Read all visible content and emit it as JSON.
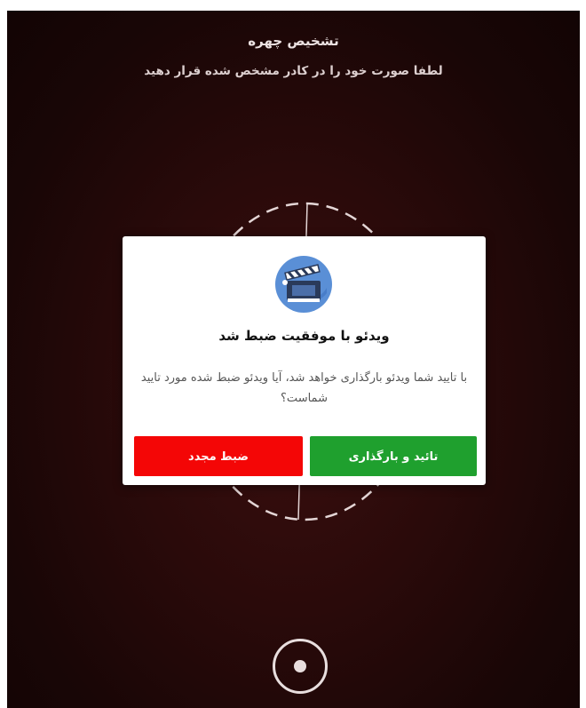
{
  "header": {
    "title": "تشخیص چهره",
    "subtitle": "لطفا صورت خود را در کادر مشخص شده قرار دهید"
  },
  "dialog": {
    "icon": "video-clapperboard-icon",
    "title": "ویدئو با موفقیت ضبط شد",
    "message": "با تایید شما ویدئو بارگذاری خواهد شد، آیا ویدئو ضبط شده مورد تایید شماست؟",
    "confirm_label": "تائید و بارگذاری",
    "retry_label": "ضبط مجدد"
  },
  "colors": {
    "confirm": "#1fa02e",
    "retry": "#f40606",
    "background": "#2a0a0a"
  },
  "icons": {
    "face_frame": "dashed-face-frame",
    "capture": "record-button-icon"
  }
}
